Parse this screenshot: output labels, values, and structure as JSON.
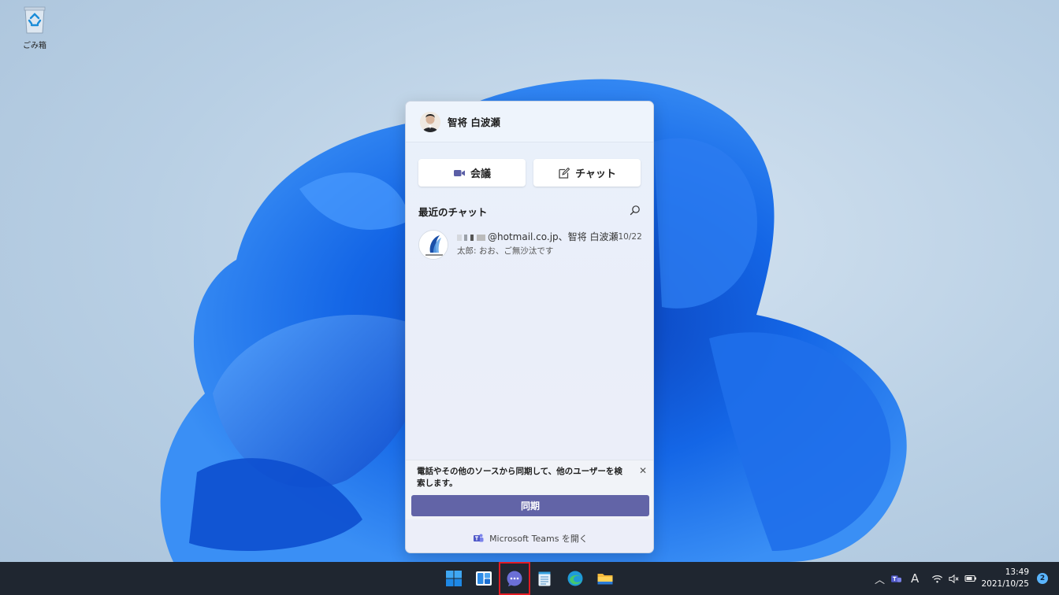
{
  "desktop": {
    "recycle_bin_label": "ごみ箱"
  },
  "teams_flyout": {
    "user_name": "智将 白波瀬",
    "meet_label": "会議",
    "chat_label": "チャット",
    "recent_title": "最近のチャット",
    "chats": [
      {
        "name": "@hotmail.co.jp、智将 白波瀬",
        "date": "10/22",
        "preview": "太郎: おお、ご無沙汰です"
      }
    ],
    "sync_message": "電話やその他のソースから同期して、他のユーザーを検索します。",
    "sync_button": "同期",
    "open_teams_label": "Microsoft Teams を開く"
  },
  "taskbar": {
    "clock_time": "13:49",
    "clock_date": "2021/10/25",
    "notification_count": "2",
    "ime_indicator": "A"
  },
  "colors": {
    "teams_accent": "#6264a7",
    "taskbar_bg": "#1f2630",
    "highlight": "#e21b23"
  }
}
